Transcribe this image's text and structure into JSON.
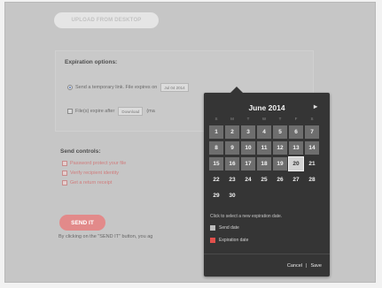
{
  "upload_button": "UPLOAD FROM DESKTOP",
  "expiration": {
    "title": "Expiration options:",
    "option1_label": "Send a temporary link. File expires on",
    "option1_date": "Jul 04 2014",
    "option2_label": "File(s) expire after",
    "option2_value": "Download",
    "option2_suffix": "(ma"
  },
  "send_controls": {
    "title": "Send controls:",
    "items": [
      "Password protect your file",
      "Verify recipient identity",
      "Get a return receipt"
    ]
  },
  "send_button": "SEND IT",
  "disclaimer": "By clicking on the \"SEND IT\" button, you ag",
  "picker": {
    "title": "June 2014",
    "next": "▸",
    "weekdays": [
      "S",
      "M",
      "T",
      "W",
      "T",
      "F",
      "S"
    ],
    "days": [
      "1",
      "2",
      "3",
      "4",
      "5",
      "6",
      "7",
      "8",
      "9",
      "10",
      "11",
      "12",
      "13",
      "14",
      "15",
      "16",
      "17",
      "18",
      "19",
      "20",
      "21",
      "22",
      "23",
      "24",
      "25",
      "26",
      "27",
      "28",
      "29",
      "30"
    ],
    "helper": "Click to select a new expiration date.",
    "legend_send": "Send date",
    "legend_expiration": "Expiration date",
    "cancel": "Cancel",
    "separator": "|",
    "save": "Save"
  },
  "colors": {
    "accent": "#e28a8a",
    "send_date_swatch": "#bdbdbd",
    "expiration_swatch": "#e2504c"
  }
}
